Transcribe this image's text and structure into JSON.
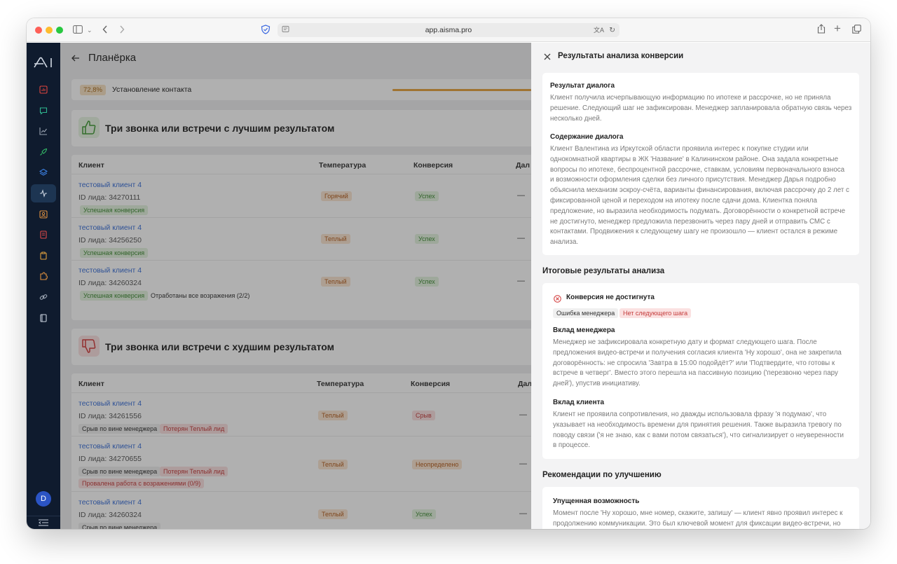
{
  "browser": {
    "url": "app.aisma.pro"
  },
  "sidebar": {
    "logo": "AI",
    "avatar_initial": "D",
    "colors": {
      "bg": "#0f1b2e",
      "active": "#1d3552"
    },
    "items": [
      {
        "icon": "chart-bar-icon",
        "color": "#e0453f"
      },
      {
        "icon": "chat-icon",
        "color": "#2fb890"
      },
      {
        "icon": "trend-line-icon",
        "color": "#9aa4b2"
      },
      {
        "icon": "rocket-icon",
        "color": "#35c26a"
      },
      {
        "icon": "layers-icon",
        "color": "#3b7fe0"
      },
      {
        "icon": "pulse-icon",
        "color": "#c9d2de"
      },
      {
        "icon": "user-card-icon",
        "color": "#e0913f"
      },
      {
        "icon": "document-icon",
        "color": "#e04848"
      },
      {
        "icon": "clipboard-icon",
        "color": "#e0a13f"
      },
      {
        "icon": "puzzle-icon",
        "color": "#e0913f"
      },
      {
        "icon": "link-icon",
        "color": "#9aa4b2"
      },
      {
        "icon": "book-icon",
        "color": "#c9d2de"
      }
    ]
  },
  "main": {
    "title": "Планёрка",
    "contact": {
      "percent": "72,8%",
      "label": "Установление контакта",
      "progress": 0.9
    },
    "best": {
      "title": "Три звонка или встречи с лучшим результатом",
      "columns": [
        "Клиент",
        "Температура",
        "Конверсия",
        "Дал"
      ],
      "rows": [
        {
          "client": "тестовый клиент 4",
          "lead": "ID лида: 34270111",
          "temp": "Горячий",
          "conv": "Успех",
          "next": "—",
          "tag1": "Успешная конверсия",
          "tag2": ""
        },
        {
          "client": "тестовый клиент 4",
          "lead": "ID лида: 34256250",
          "temp": "Теплый",
          "conv": "Успех",
          "next": "—",
          "tag1": "Успешная конверсия",
          "tag2": ""
        },
        {
          "client": "тестовый клиент 4",
          "lead": "ID лида: 34260324",
          "temp": "Теплый",
          "conv": "Успех",
          "next": "—",
          "tag1": "Успешная конверсия",
          "tag2": "Отработаны все возражения (2/2)"
        }
      ]
    },
    "worst": {
      "title": "Три звонка или встречи с худшим результатом",
      "columns": [
        "Клиент",
        "Температура",
        "Конверсия",
        "Дал"
      ],
      "rows": [
        {
          "client": "тестовый клиент 4",
          "lead": "ID лида: 34261556",
          "temp": "Теплый",
          "conv": "Срыв",
          "next": "—",
          "tag1": "Срыв по вине менеджера",
          "tag2": "Потерян Теплый лид",
          "tag3": ""
        },
        {
          "client": "тестовый клиент 4",
          "lead": "ID лида: 34270655",
          "temp": "Теплый",
          "conv": "Неопределено",
          "next": "—",
          "tag1": "Срыв по вине менеджера",
          "tag2": "Потерян Теплый лид",
          "tag3": "Провалена работа с возражениями (0/9)"
        },
        {
          "client": "тестовый клиент 4",
          "lead": "ID лида: 34260324",
          "temp": "Теплый",
          "conv": "Успех",
          "next": "—",
          "tag1": "Срыв по вине менеджера",
          "tag2": "",
          "tag3": ""
        }
      ]
    }
  },
  "panel": {
    "title": "Результаты анализа конверсии",
    "dialog_result": {
      "heading": "Результат диалога",
      "lines": [
        "Клиент получила исчерпывающую информацию по ипотеке и рассрочке, но не приняла",
        "решение. Следующий шаг не зафиксирован. Менеджер запланировала обратную связь через",
        "несколько дней."
      ]
    },
    "dialog_content": {
      "heading": "Содержание диалога",
      "lines": [
        "Клиент Валентина из Иркутской области проявила интерес к покупке студии или",
        "однокомнатной квартиры в ЖК 'Название' в Калининском районе. Она задала конкретные",
        "вопросы по ипотеке, беспроцентной рассрочке, ставкам, условиям первоначального взноса",
        "и возможности оформления сделки без личного присутствия. Менеджер Дарья подробно",
        "объяснила механизм эскроу-счёта, варианты финансирования, включая рассрочку до 2 лет с",
        "фиксированной ценой и переходом на ипотеку после сдачи дома. Клиентка поняла",
        "предложение, но выразила необходимость подумать. Договорённости о конкретной встрече",
        "не достигнуто, менеджер предложила перезвонить через пару дней и отправить СМС с",
        "контактами. Продвижения к следующему шагу не произошло — клиент остался в режиме",
        "анализа."
      ]
    },
    "final_heading": "Итоговые результаты анализа",
    "final": {
      "status": "Конверсия не достигнута",
      "tag1": "Ошибка менеджера",
      "tag2": "Нет следующего шага",
      "manager_heading": "Вклад менеджера",
      "manager_lines": [
        "Менеджер не зафиксировала конкретную дату и формат следующего шага. После",
        "предложения видео-встречи и получения согласия клиента 'Ну хорошо', она не закрепила",
        "договорённость: не спросила 'Завтра в 15:00 подойдёт?' или 'Подтвердите, что готовы к",
        "встрече в четверг'. Вместо этого перешла на пассивную позицию ('перезвоню через пару",
        "дней'), упустив инициативу."
      ],
      "client_heading": "Вклад клиента",
      "client_lines": [
        "Клиент не проявила сопротивления, но дважды использовала фразу 'я подумаю', что",
        "указывает на необходимость времени для принятия решения. Также выразила тревогу по",
        "поводу связи ('я не знаю, как с вами потом связаться'), что сигнализирует о неуверенности",
        "в процессе."
      ]
    },
    "recs_heading": "Рекомендации по улучшению",
    "recs": {
      "heading": "Упущенная возможность",
      "lines": [
        "Момент после 'Ну хорошо, мне номер, скажите, запишу' — клиент явно проявил интерес к",
        "продолжению коммуникации. Это был ключевой момент для фиксации видео-встречи, но"
      ]
    }
  }
}
